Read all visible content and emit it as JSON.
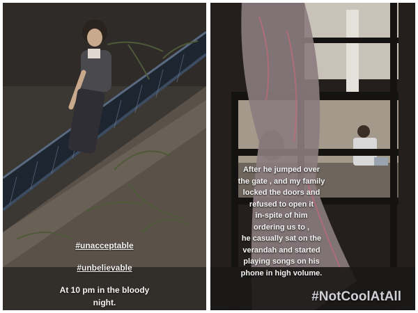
{
  "left_story": {
    "hashtag_1": "#unacceptable",
    "hashtag_2": "#unbelievable",
    "caption_line_1": "At 10 pm in the bloody",
    "caption_line_2": "night."
  },
  "right_story": {
    "text_lines": [
      "After he jumped over",
      "the gate , and my family",
      "locked the doors and",
      "refused to open it",
      "in-spite of him",
      "ordering us to ,",
      "he casually sat on the",
      "verandah and started",
      "playing songs on his",
      "phone in high volume."
    ],
    "hashtag": "#NotCoolAtAll"
  },
  "colors": {
    "background": "#ffffff",
    "left_wall": "#4a4540",
    "railing": "#2c3a4a",
    "right_dark": "#1e1b1a"
  }
}
